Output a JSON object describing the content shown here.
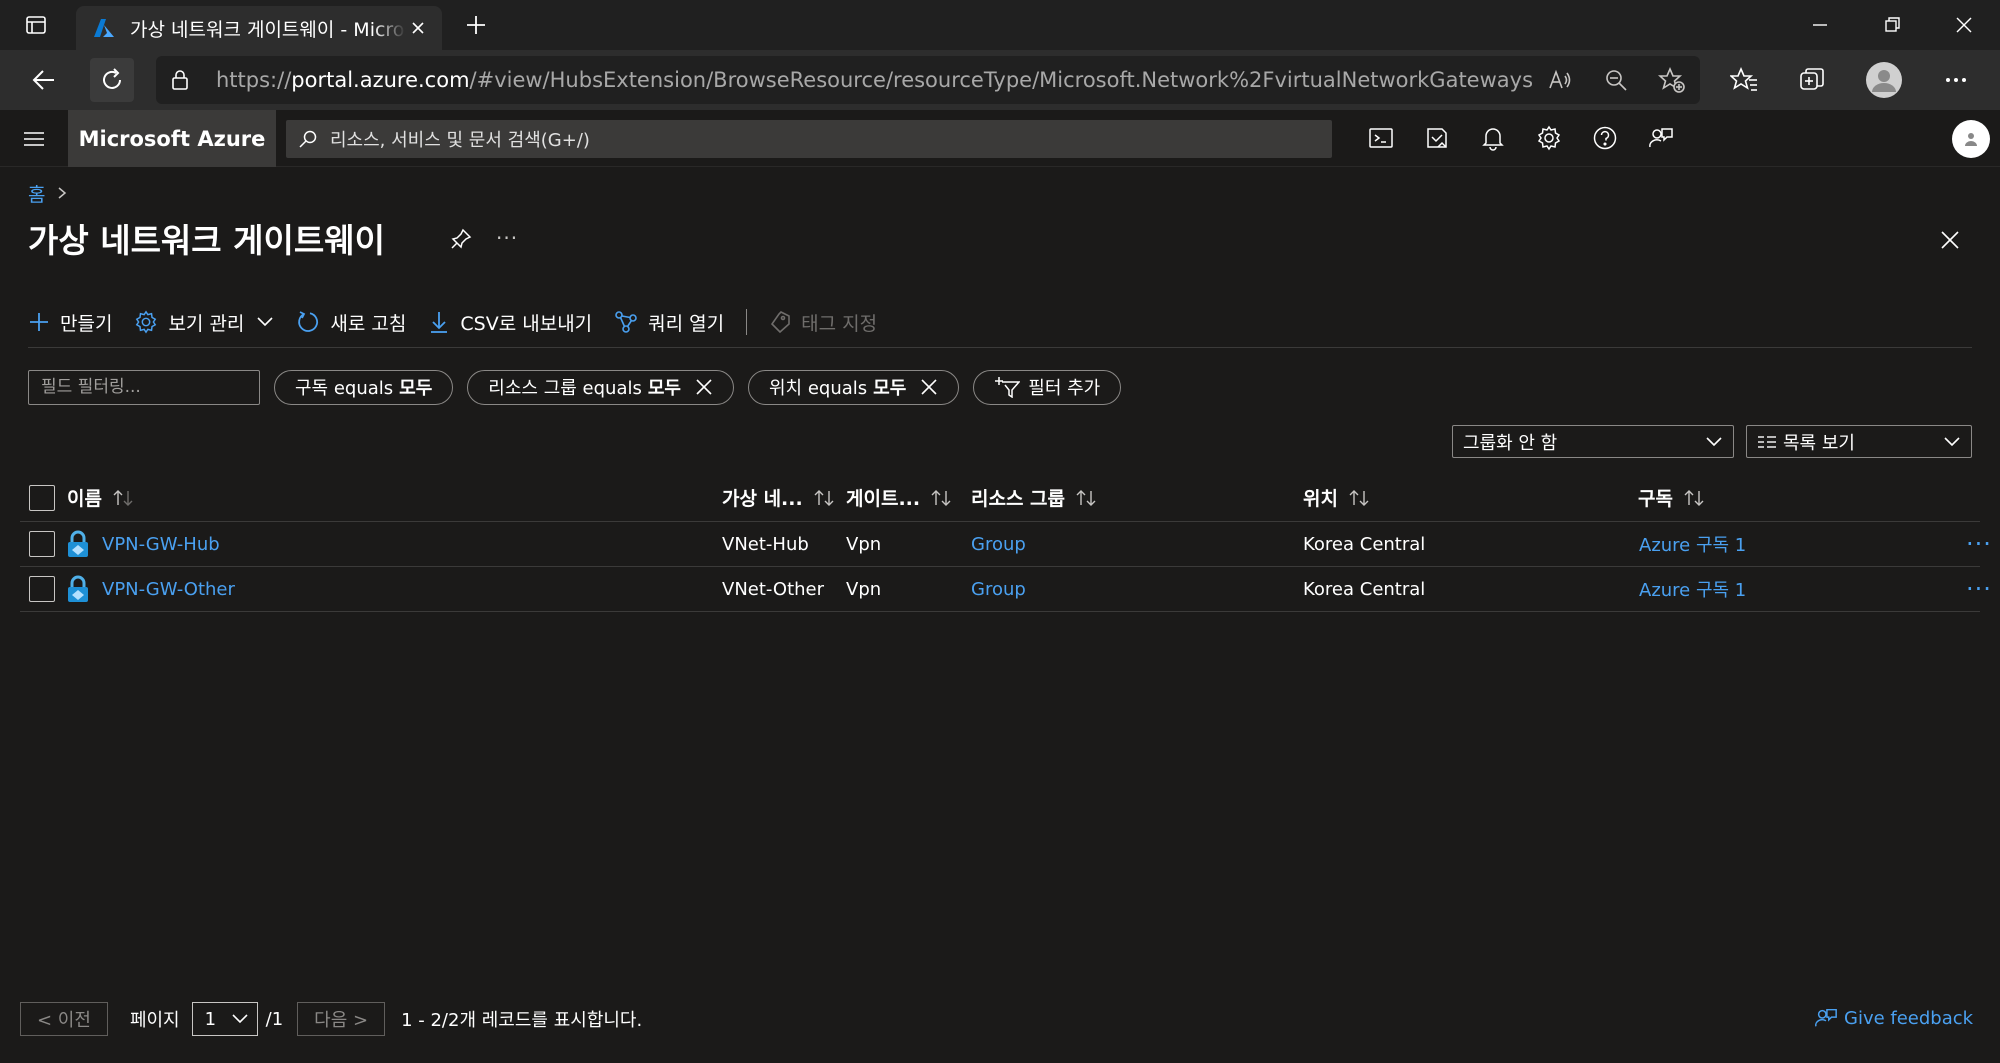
{
  "browser": {
    "tab_title": "가상 네트워크 게이트웨이 - Microsoft Azure",
    "url_prefix": "https://",
    "url_host": "portal.azure.com",
    "url_path": "/#view/HubsExtension/BrowseResource/resourceType/Microsoft.Network%2FvirtualNetworkGateways"
  },
  "azure": {
    "brand": "Microsoft Azure",
    "search_placeholder": "리소스, 서비스 및 문서 검색(G+/)"
  },
  "page": {
    "breadcrumb_home": "홈",
    "title": "가상 네트워크 게이트웨이",
    "more": "···"
  },
  "commands": {
    "create": "만들기",
    "manage_view": "보기 관리",
    "refresh": "새로 고침",
    "export_csv": "CSV로 내보내기",
    "open_query": "쿼리 열기",
    "assign_tags": "태그 지정"
  },
  "filters": {
    "field_placeholder": "필드 필터링...",
    "subscription": {
      "label": "구독 equals",
      "value": "모두"
    },
    "resource_group": {
      "label": "리소스 그룹 equals",
      "value": "모두"
    },
    "location": {
      "label": "위치 equals",
      "value": "모두"
    },
    "add_filter": "필터 추가"
  },
  "view": {
    "grouping": "그룹화 안 함",
    "list_view": "목록 보기"
  },
  "table": {
    "columns": {
      "name": "이름",
      "vnet": "가상 네...",
      "gateway_type": "게이트...",
      "resource_group": "리소스 그룹",
      "location": "위치",
      "subscription": "구독"
    },
    "rows": [
      {
        "name": "VPN-GW-Hub",
        "vnet": "VNet-Hub",
        "gateway_type": "Vpn",
        "resource_group": "Group",
        "location": "Korea Central",
        "subscription": "Azure 구독 1"
      },
      {
        "name": "VPN-GW-Other",
        "vnet": "VNet-Other",
        "gateway_type": "Vpn",
        "resource_group": "Group",
        "location": "Korea Central",
        "subscription": "Azure 구독 1"
      }
    ],
    "row_more": "···"
  },
  "footer": {
    "prev": "< 이전",
    "page_label": "페이지",
    "page_value": "1",
    "page_total": "/1",
    "next": "다음 >",
    "record_count": "1 - 2/2개 레코드를 표시합니다.",
    "feedback": "Give feedback"
  },
  "colors": {
    "background": "#1b1a19",
    "link": "#4aa0f0",
    "border": "#8a8886"
  }
}
